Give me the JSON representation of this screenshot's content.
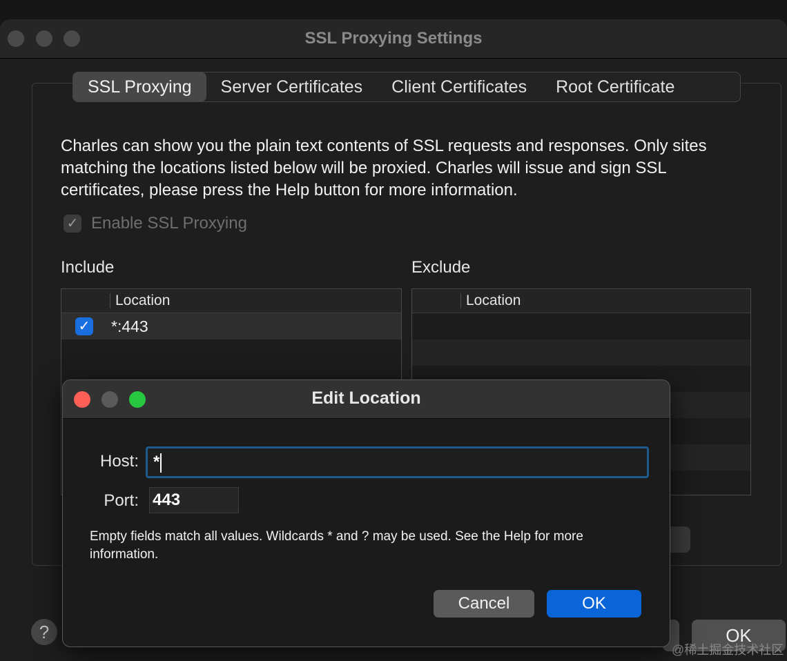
{
  "window": {
    "title": "SSL Proxying Settings"
  },
  "tabs": [
    "SSL Proxying",
    "Server Certificates",
    "Client Certificates",
    "Root Certificate"
  ],
  "description": "Charles can show you the plain text contents of SSL requests and responses. Only sites matching the locations listed below will be proxied. Charles will issue and sign SSL certificates, please press the Help button for more information.",
  "enable": {
    "label": "Enable SSL Proxying",
    "checked": true
  },
  "include": {
    "label": "Include",
    "column": "Location",
    "rows": [
      {
        "checked": true,
        "location": "*:443"
      }
    ]
  },
  "exclude": {
    "label": "Exclude",
    "column": "Location",
    "rows": []
  },
  "footer": {
    "help": "?",
    "ok": "OK"
  },
  "dialog": {
    "title": "Edit Location",
    "host_label": "Host:",
    "host_value": "*",
    "port_label": "Port:",
    "port_value": "443",
    "help_text": "Empty fields match all values. Wildcards * and ? may be used. See the Help for more information.",
    "cancel": "Cancel",
    "ok": "OK"
  },
  "watermark": "@稀土掘金技术社区",
  "colors": {
    "accent": "#0a66d8",
    "focus_ring": "#1f5a8c",
    "close": "#fe5f57",
    "minimize": "#5a5a5a",
    "zoom": "#27c840"
  }
}
